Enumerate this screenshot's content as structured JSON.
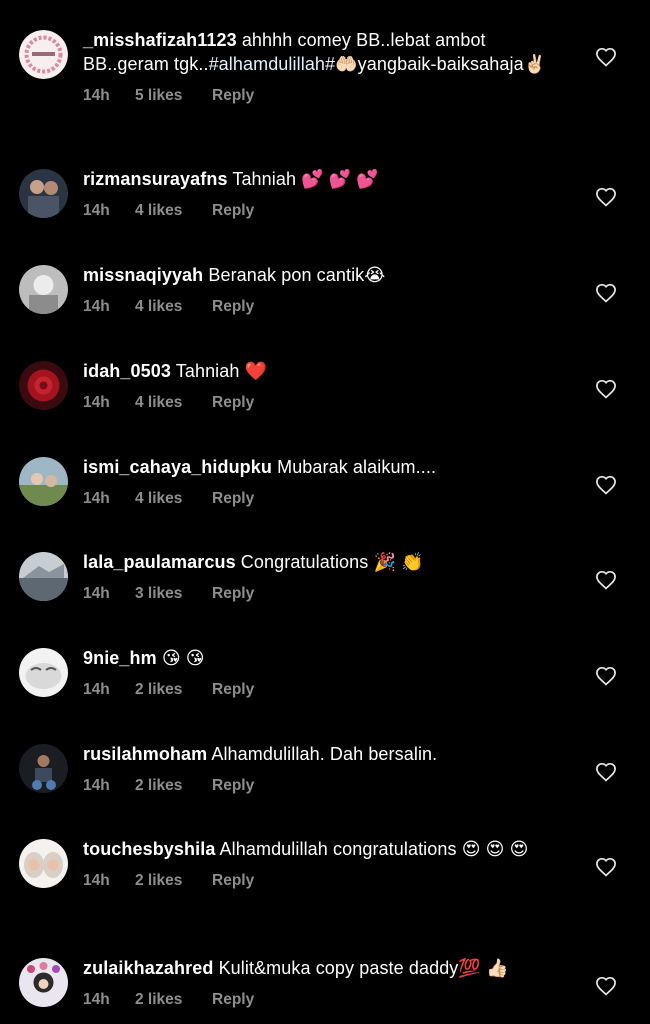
{
  "comments": [
    {
      "username": "_misshafizah1123",
      "text_parts": [
        "ahhhh comey BB..lebat ambot BB..geram tgk..",
        "#alhamdulillah#",
        "🤲🏻yangbaik-baiksahaja✌🏻"
      ],
      "time": "14h",
      "likes": "5 likes",
      "reply": "Reply"
    },
    {
      "username": "rizmansurayafns",
      "text": "Tahniah 💕 💕 💕",
      "time": "14h",
      "likes": "4 likes",
      "reply": "Reply"
    },
    {
      "username": "missnaqiyyah",
      "text": "Beranak pon cantik😭",
      "time": "14h",
      "likes": "4 likes",
      "reply": "Reply"
    },
    {
      "username": "idah_0503",
      "text": "Tahniah ❤️",
      "time": "14h",
      "likes": "4 likes",
      "reply": "Reply"
    },
    {
      "username": "ismi_cahaya_hidupku",
      "text": "Mubarak alaikum....",
      "time": "14h",
      "likes": "4 likes",
      "reply": "Reply"
    },
    {
      "username": "lala_paulamarcus",
      "text": "Congratulations 🎉 👏",
      "time": "14h",
      "likes": "3 likes",
      "reply": "Reply"
    },
    {
      "username": "9nie_hm",
      "text": "😘 😘",
      "time": "14h",
      "likes": "2 likes",
      "reply": "Reply"
    },
    {
      "username": "rusilahmoham",
      "text": "Alhamdulillah. Dah bersalin.",
      "time": "14h",
      "likes": "2 likes",
      "reply": "Reply"
    },
    {
      "username": "touchesbyshila",
      "text": "Alhamdulillah congratulations 😍 😍 😍",
      "time": "14h",
      "likes": "2 likes",
      "reply": "Reply"
    },
    {
      "username": "zulaikhazahred",
      "text": "Kulit&muka copy paste daddy💯 👍🏻",
      "time": "14h",
      "likes": "2 likes",
      "reply": "Reply"
    }
  ],
  "icons": {
    "like": "heart-outline-icon"
  },
  "colors": {
    "background": "#000000",
    "text": "#ffffff",
    "meta": "#8e8e8e",
    "hashtag": "#e0f1ff"
  }
}
